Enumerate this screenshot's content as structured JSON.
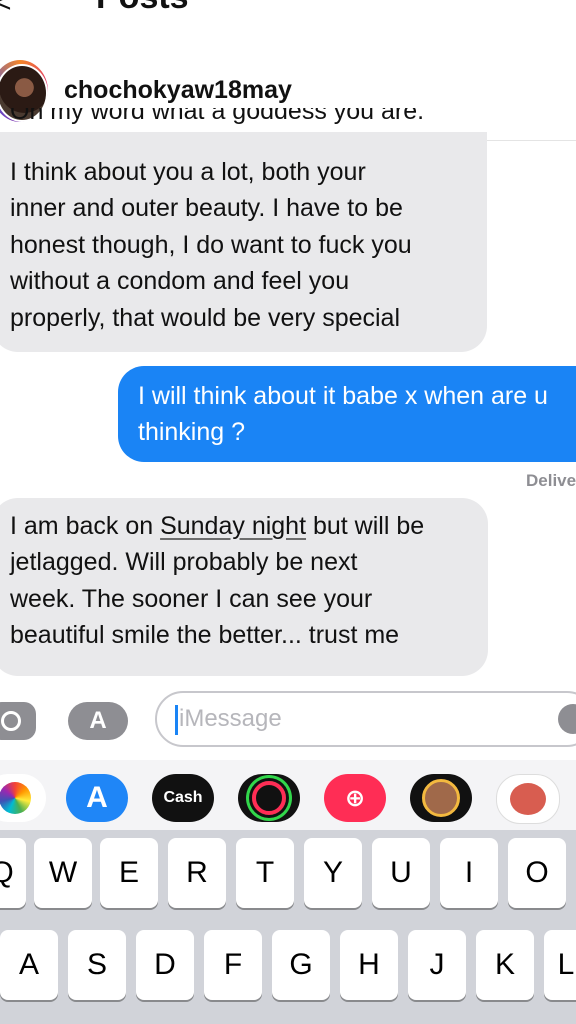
{
  "header": {
    "back_glyph": "<",
    "title_fragment": "Posts",
    "username": "chochokyaw18may"
  },
  "conversation": {
    "message_1": {
      "cut_line": "Oh my word what a goddess you are.",
      "lines": [
        "I think about you a lot, both your",
        "inner and outer beauty. I have to be",
        "honest though, I do want to fuck you",
        "without a condom and feel you",
        "properly, that would be very special"
      ]
    },
    "message_2": {
      "lines": [
        "I will think about it babe x when are u",
        "thinking ?"
      ]
    },
    "status": "Delivered",
    "message_3": {
      "line1_prefix": "I am back on ",
      "line1_link": "Sunday night",
      "line1_suffix": " but will be",
      "lines": [
        "jetlagged. Will probably be next",
        "week.  The sooner I can see your",
        "beautiful smile the better... trust me"
      ]
    }
  },
  "composer": {
    "placeholder": "iMessage",
    "apps_glyph": "A"
  },
  "app_tray": {
    "cash_label": "Cash",
    "appstore_glyph": "A",
    "search_glyph": "⊕",
    "icons": [
      "photos-icon",
      "app-store-icon",
      "apple-cash-icon",
      "activity-icon",
      "image-search-icon",
      "memoji-icon",
      "stickers-icon"
    ]
  },
  "keyboard": {
    "row1": [
      "Q",
      "W",
      "E",
      "R",
      "T",
      "Y",
      "U",
      "I",
      "O"
    ],
    "row2": [
      "A",
      "S",
      "D",
      "F",
      "G",
      "H",
      "J",
      "K",
      "L"
    ]
  },
  "colors": {
    "outgoing_bubble": "#1a84f5",
    "incoming_bubble": "#e9e9eb",
    "keyboard": "#d1d3d9"
  }
}
